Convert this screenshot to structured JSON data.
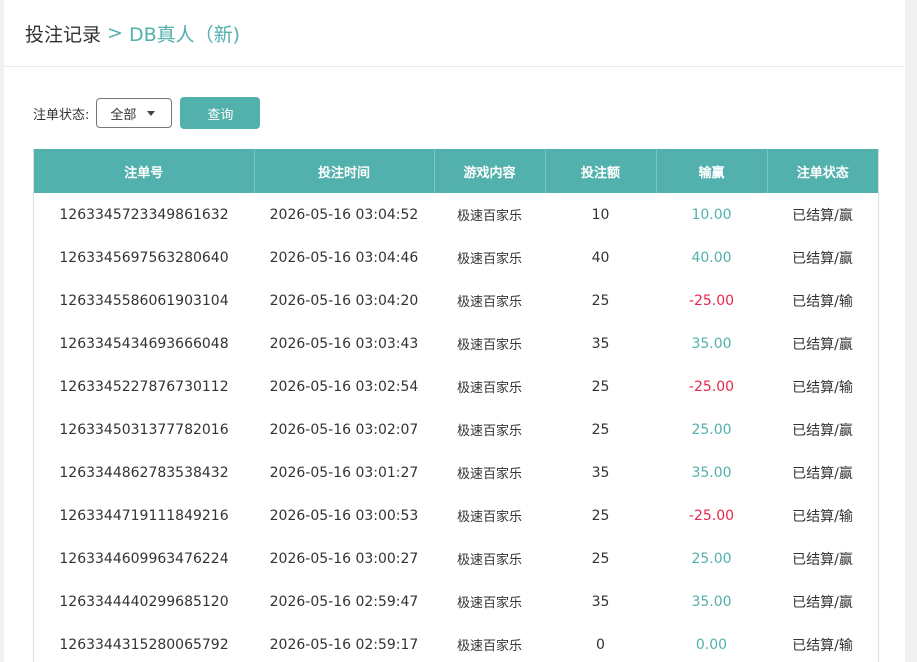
{
  "breadcrumb": {
    "root": "投注记录",
    "separator": ">",
    "current": "DB真人（新)"
  },
  "filter": {
    "label": "注单状态:",
    "selected": "全部",
    "button": "查询"
  },
  "table": {
    "columns": [
      "注单号",
      "投注时间",
      "游戏内容",
      "投注额",
      "输赢",
      "注单状态"
    ],
    "rows": [
      {
        "id": "1263345723349861632",
        "time": "2026-05-16 03:04:52",
        "game": "极速百家乐",
        "amount": "10",
        "result": "10.00",
        "result_type": "win",
        "status": "已结算/赢"
      },
      {
        "id": "1263345697563280640",
        "time": "2026-05-16 03:04:46",
        "game": "极速百家乐",
        "amount": "40",
        "result": "40.00",
        "result_type": "win",
        "status": "已结算/赢"
      },
      {
        "id": "1263345586061903104",
        "time": "2026-05-16 03:04:20",
        "game": "极速百家乐",
        "amount": "25",
        "result": "-25.00",
        "result_type": "lose",
        "status": "已结算/输"
      },
      {
        "id": "1263345434693666048",
        "time": "2026-05-16 03:03:43",
        "game": "极速百家乐",
        "amount": "35",
        "result": "35.00",
        "result_type": "win",
        "status": "已结算/赢"
      },
      {
        "id": "1263345227876730112",
        "time": "2026-05-16 03:02:54",
        "game": "极速百家乐",
        "amount": "25",
        "result": "-25.00",
        "result_type": "lose",
        "status": "已结算/输"
      },
      {
        "id": "1263345031377782016",
        "time": "2026-05-16 03:02:07",
        "game": "极速百家乐",
        "amount": "25",
        "result": "25.00",
        "result_type": "win",
        "status": "已结算/赢"
      },
      {
        "id": "1263344862783538432",
        "time": "2026-05-16 03:01:27",
        "game": "极速百家乐",
        "amount": "35",
        "result": "35.00",
        "result_type": "win",
        "status": "已结算/赢"
      },
      {
        "id": "1263344719111849216",
        "time": "2026-05-16 03:00:53",
        "game": "极速百家乐",
        "amount": "25",
        "result": "-25.00",
        "result_type": "lose",
        "status": "已结算/输"
      },
      {
        "id": "1263344609963476224",
        "time": "2026-05-16 03:00:27",
        "game": "极速百家乐",
        "amount": "25",
        "result": "25.00",
        "result_type": "win",
        "status": "已结算/赢"
      },
      {
        "id": "1263344440299685120",
        "time": "2026-05-16 02:59:47",
        "game": "极速百家乐",
        "amount": "35",
        "result": "35.00",
        "result_type": "win",
        "status": "已结算/赢"
      },
      {
        "id": "1263344315280065792",
        "time": "2026-05-16 02:59:17",
        "game": "极速百家乐",
        "amount": "0",
        "result": "0.00",
        "result_type": "zero",
        "status": "已结算/输"
      }
    ]
  },
  "colors": {
    "accent": "#52b0ad",
    "lose": "#e8264b"
  }
}
